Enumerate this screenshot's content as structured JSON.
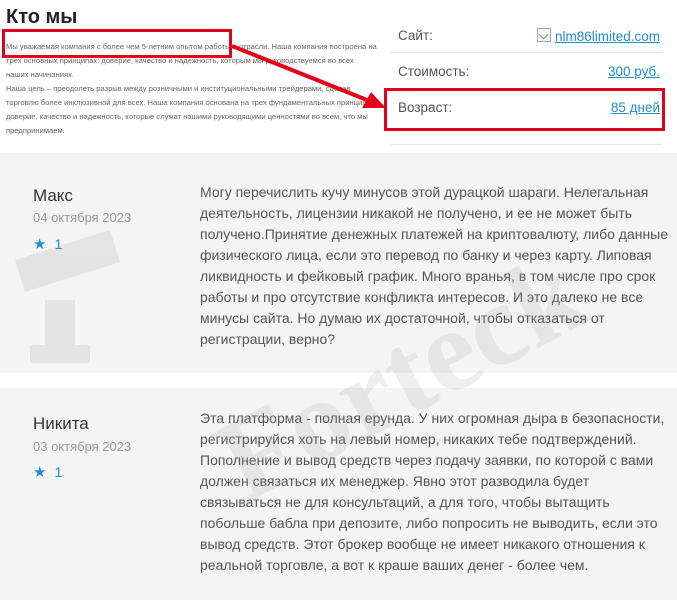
{
  "about": {
    "title": "Кто мы",
    "paragraph1": "Мы уважаемая компания с более чем 5-летним опытом работы в отрасли. Наша компания построена на трех основных принципах: доверие, качество и надежность, которым мы руководствуемся во всех наших начинаниях.",
    "paragraph2": "Наша цель – преодолеть разрыв между розничными и институциональными трейдерами, сделав торговлю более инклюзивной для всех. Наша компания основана на трех фундаментальных принципах: доверие, качество и надежность, которые служат нашими руководящими ценностями во всем, что мы предпринимаем."
  },
  "info": {
    "site_label": "Сайт:",
    "site_value": "nlm86limited.com",
    "cost_label": "Стоимость:",
    "cost_value": "300 руб.",
    "age_label": "Возраст:",
    "age_value": "85 дней"
  },
  "reviews": [
    {
      "name": "Макс",
      "date": "04 октября 2023",
      "rating": "1",
      "text": "Могу перечислить кучу минусов этой дурацкой шараги. Нелегальная деятельность, лицензии никакой не получено, и ее не может быть получено.Принятие денежных платежей на криптовалюту, либо данные физического лица, если это перевод по банку и через карту. Липовая ликвидность и фейковый график. Много вранья, в том числе про срок работы и про отсутствие конфликта интересов. И это далеко не все минусы сайта. Но думаю их достаточной, чтобы отказаться от регистрации, верно?"
    },
    {
      "name": "Никита",
      "date": "03 октября 2023",
      "rating": "1",
      "text": "Эта платформа - полная ерунда. У них огромная дыра в безопасности, регистрируйся хоть на левый номер, никаких тебе подтверждений. Пополнение и вывод средств через подачу заявки, по которой с вами должен связаться их менеджер. Явно этот разводила будет связываться не для консультаций, а для того, чтобы вытащить побольше бабла при депозите, либо попросить не выводить, если это вывод средств. Этот брокер вообще не имеет никакого отношения к реальной торговле, а вот к краше ваших денег - более чем."
    }
  ],
  "watermark": {
    "text": "Forteck"
  },
  "colors": {
    "accent": "#e3001b",
    "link": "#1e8fc7"
  }
}
